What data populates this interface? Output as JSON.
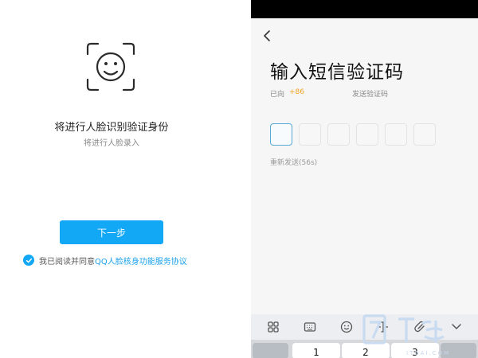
{
  "left": {
    "title": "将进行人脸识别验证身份",
    "subtitle": "将进行人脸录入",
    "next_button": "下一步",
    "agreement_prefix": "我已阅读并同意",
    "agreement_link": "QQ人脸核身功能服务协议",
    "checkbox_checked": true,
    "accent_color": "#12a8f5"
  },
  "right": {
    "back_icon": "chevron-left-icon",
    "title": "输入短信验证码",
    "sent_to_label": "已向",
    "phone_prefix": "+86",
    "send_code_label": "发送验证码",
    "code_boxes": [
      "",
      "",
      "",
      "",
      "",
      ""
    ],
    "active_box_index": 0,
    "resend_label": "重新发送(56s)",
    "keyboard": {
      "toolbar_icons": [
        "grid-icon",
        "keyboard-icon",
        "emoji-icon",
        "cursor-icon",
        "clip-icon",
        "collapse-icon"
      ],
      "keys": [
        "1",
        "2",
        "3"
      ]
    },
    "highlight_color": "#f0a11c"
  },
  "watermark": {
    "logo": "IT袋",
    "text": "ITDAI.COM"
  }
}
